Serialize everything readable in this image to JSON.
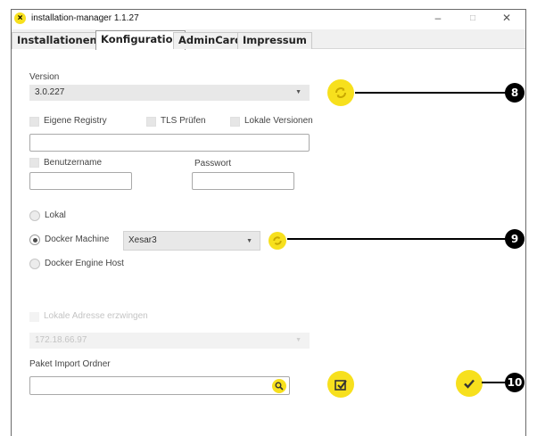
{
  "window": {
    "app_icon_glyph": "×",
    "title": "installation-manager 1.1.27",
    "controls": {
      "minimize": "–",
      "maximize": "□",
      "close": "✕"
    }
  },
  "tabs": [
    {
      "label": "Installationen",
      "active": false
    },
    {
      "label": "Konfiguration",
      "active": true
    },
    {
      "label": "AdminCard",
      "active": false
    },
    {
      "label": "Impressum",
      "active": false
    }
  ],
  "version": {
    "label": "Version",
    "value": "3.0.227",
    "refresh_icon": "refresh-icon"
  },
  "options": {
    "eigene_registry": {
      "label": "Eigene Registry",
      "checked": false
    },
    "tls_pruefen": {
      "label": "TLS Prüfen",
      "checked": false
    },
    "lokale_versionen": {
      "label": "Lokale Versionen",
      "checked": false
    },
    "registry_url": {
      "value": ""
    }
  },
  "auth": {
    "benutzername": {
      "label": "Benutzername",
      "checked": false,
      "value": ""
    },
    "passwort": {
      "label": "Passwort",
      "value": ""
    }
  },
  "target": {
    "lokal": {
      "label": "Lokal",
      "selected": false
    },
    "docker_machine": {
      "label": "Docker Machine",
      "selected": true,
      "value": "Xesar3",
      "refresh_icon": "refresh-icon"
    },
    "docker_engine_host": {
      "label": "Docker Engine Host",
      "selected": false
    }
  },
  "address": {
    "force_label": "Lokale Adresse erzwingen",
    "force_checked": false,
    "ip_value": "172.18.66.97",
    "disabled": true
  },
  "import": {
    "label": "Paket Import Ordner",
    "value": "",
    "search_icon": "search-icon",
    "import_icon": "import-icon"
  },
  "confirm": {
    "icon": "checkmark-icon"
  },
  "callouts": [
    "8",
    "9",
    "10"
  ],
  "colors": {
    "accent_yellow": "#f7e01d",
    "callout_black": "#000000"
  }
}
